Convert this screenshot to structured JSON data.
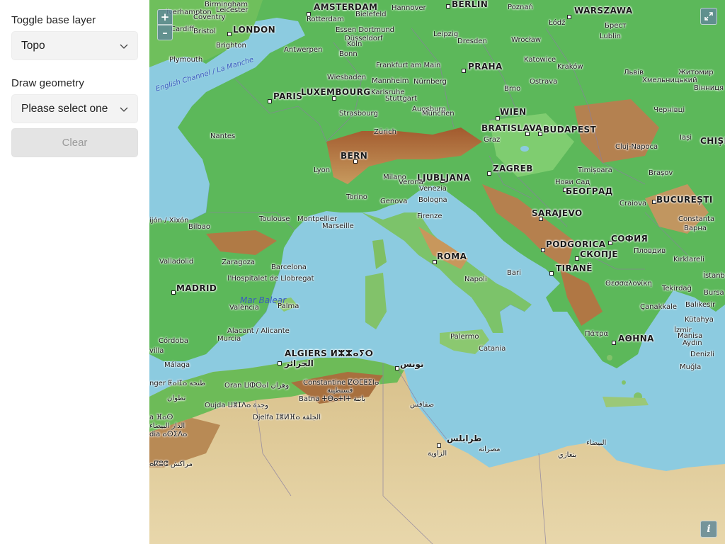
{
  "sidebar": {
    "base_layer_label": "Toggle base layer",
    "base_layer_value": "Topo",
    "draw_label": "Draw geometry",
    "draw_value": "Please select one",
    "clear_label": "Clear"
  },
  "map": {
    "zoom_in": "+",
    "zoom_out": "–",
    "fullscreen_icon": "expand-icon",
    "info": "i",
    "seas": {
      "english_channel": "English Channel / La Manche",
      "mar_balear": "Mar Balear"
    },
    "capitals": {
      "amsterdam": "AMSTERDAM",
      "berlin": "BERLIN",
      "warszawa": "WARSZAWA",
      "london": "LONDON",
      "praha": "PRAHA",
      "paris": "PARIS",
      "luxembourg": "LUXEMBOURG",
      "wien": "WIEN",
      "bratislava": "BRATISLAVA",
      "budapest": "BUDAPEST",
      "chisinau": "CHIȘI",
      "bern": "BERN",
      "ljubljana": "LJUBLJANA",
      "zagreb": "ZAGREB",
      "beograd": "БЕОГРАД",
      "bucuresti": "BUCUREȘTI",
      "sarajevo": "SARAJEVO",
      "podgorica": "PODGORICA",
      "sofia": "СОФИЯ",
      "skopje": "СКОПЈЕ",
      "madrid": "MADRID",
      "roma": "ROMA",
      "tirane": "TIRANË",
      "athina": "ΑΘΗΝΑ",
      "algiers": "ALGIERS ⵍⵣⵣⴰⵢⵔ",
      "algiers_ar": "الجزائر",
      "tunis": "تونس",
      "tripoli": "طرابلس"
    },
    "cities": {
      "birmingham": "Birmingham",
      "leicester": "Leicester",
      "wolverhampton": "lverhampton",
      "coventry": "Coventry",
      "cardiff": "Cardiff",
      "bristol": "Bristol",
      "brighton": "Brighton",
      "plymouth": "Plymouth",
      "hannover": "Hannover",
      "poznan": "Poznań",
      "rotterdam": "Rotterdam",
      "bielefeld": "Bielefeld",
      "essen": "Essen Dortmund",
      "duesseldorf": "Düsseldorf",
      "koeln": "Köln",
      "antwerpen": "Antwerpen",
      "bonn": "Bonn",
      "leipzig": "Leipzig",
      "dresden": "Dresden",
      "lodz": "Łódź",
      "brest": "Брест",
      "lublin": "Lublin",
      "wroclaw": "Wrocław",
      "frankfurt": "Frankfurt am Main",
      "katowice": "Katowice",
      "krakow": "Kraków",
      "lviv": "Львів",
      "zhytomyr": "Житомир",
      "khmelnytskyi": "Хмельницький",
      "vinnytsia": "Вінниця",
      "wiesbaden": "Wiesbaden",
      "mannheim": "Mannheim",
      "nuernberg": "Nürnberg",
      "karlsruhe": "Karlsruhe",
      "stuttgart": "Stuttgart",
      "ostrava": "Ostrava",
      "brno": "Brno",
      "augsburg": "Augsburg",
      "muenchen": "München",
      "strasbourg": "Strasbourg",
      "chernivtsi": "Чернівці",
      "zuerich": "Zürich",
      "graz": "Graz",
      "iasi": "Iași",
      "cluj": "Cluj-Napoca",
      "nantes": "Nantes",
      "lyon": "Lyon",
      "milano": "Milano",
      "verona": "Verona",
      "venezia": "Venezia",
      "torino": "Torino",
      "timisoara": "Timișoara",
      "novi_sad": "Нови Сад",
      "brasov": "Brașov",
      "genova": "Genova",
      "bologna": "Bologna",
      "firenze": "Firenze",
      "craiova": "Craiova",
      "constanta": "Constanța",
      "varna": "Варна",
      "gijon": "ijón / Xixón",
      "bilbao": "Bilbao",
      "toulouse": "Toulouse",
      "montpellier": "Montpellier",
      "marseille": "Marseille",
      "plovdiv": "Пловдив",
      "valladolid": "Valladolid",
      "zaragoza": "Zaragoza",
      "barcelona": "Barcelona",
      "bari": "Bari",
      "kirklareli": "Kırklareli",
      "istanbul": "İstanbu",
      "hospitalet": "l'Hospitalet de Llobregat",
      "napoli": "Napoli",
      "thessaloniki": "Θεσσαλονίκη",
      "tekirdag": "Tekirdağ",
      "bursa": "Bursa",
      "valencia": "València",
      "palma": "Palma",
      "canakkale": "Çanakkale",
      "balikesir": "Balıkesir",
      "kutahya": "Kütahya",
      "alacant": "Alacant / Alicante",
      "patra": "Πάτρα",
      "palermo": "Palermo",
      "izmir": "İzmir",
      "manisa": "Manisa",
      "aydin": "Aydın",
      "denizli": "Denizli",
      "cordoba": "Córdoba",
      "murcia": "Murcia",
      "catania": "Catania",
      "sevilla": "villa",
      "malaga": "Málaga",
      "mugla": "Muğla",
      "tanger": "nger ⵟⴰⵏⵊⴰ طنجة",
      "tetouan": "تطوان",
      "constantine": "Constantine ⵇⵙⵎⵟⵉⵏⴰ",
      "constantine_ar": "قسنطينة",
      "oran": "Oran ⵡⵀⵔⴰⵏ وهران",
      "batna": "Batna ⵜⴱⴰⵜⵏⵜ باتنة",
      "oujda": "Oujda ⵡⴻⵊⴷⴰ وجدة",
      "fes": "a ⴼⴰⵙ",
      "sfax": "صفاقس",
      "djelfa": "Djelfa ⵊⴻⵍⴼⴰ الجلفة",
      "misrata": "مصراتة",
      "zawiya": "الزاوية",
      "benghazi": "بنغازي",
      "bayda": "البيضاء",
      "marrakech": "ⴰⴽⵓⵛ مراكش",
      "fes_ar": "الدار البيضاء",
      "fes2": "dia ⴰⵙⵉⴷⴰ"
    }
  }
}
